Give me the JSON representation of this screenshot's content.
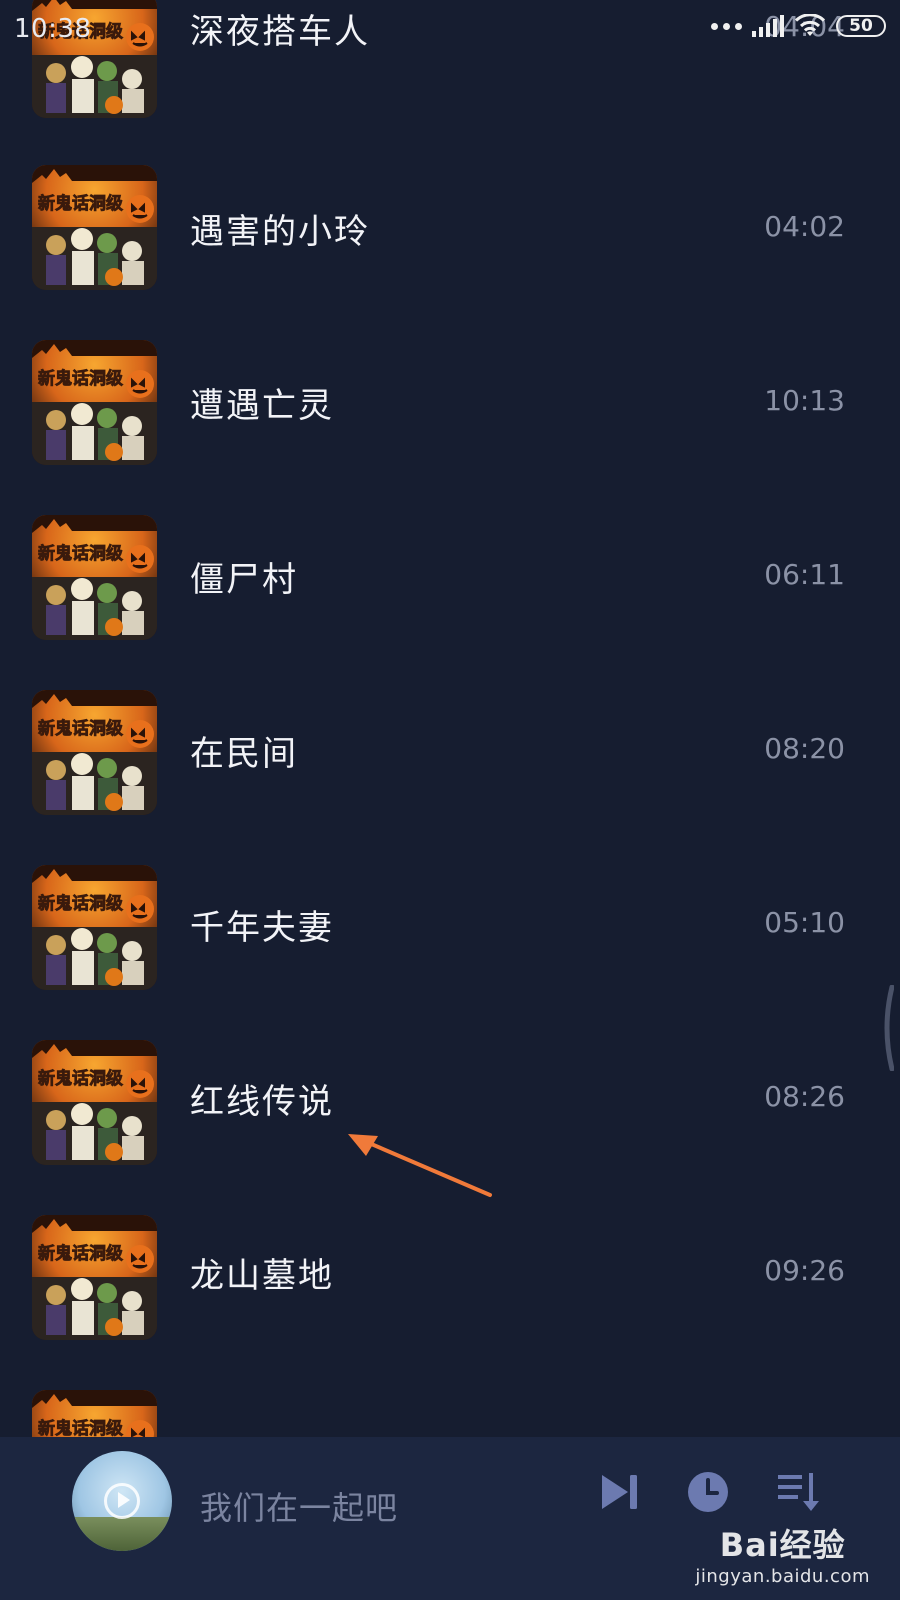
{
  "status_bar": {
    "time": "10:38",
    "battery": "50"
  },
  "tracks": [
    {
      "title": "深夜搭车人",
      "duration": "04:04"
    },
    {
      "title": "遇害的小玲",
      "duration": "04:02"
    },
    {
      "title": "遭遇亡灵",
      "duration": "10:13"
    },
    {
      "title": "僵尸村",
      "duration": "06:11"
    },
    {
      "title": "在民间",
      "duration": "08:20"
    },
    {
      "title": "千年夫妻",
      "duration": "05:10"
    },
    {
      "title": "红线传说",
      "duration": "08:26"
    },
    {
      "title": "龙山墓地",
      "duration": "09:26"
    },
    {
      "title": "",
      "duration": ""
    }
  ],
  "cover_text": "新鬼话洞级",
  "player": {
    "now_playing": "我们在一起吧",
    "icons": [
      "next-track-icon",
      "timer-icon",
      "playlist-icon"
    ]
  },
  "watermark": {
    "logo": "Bai经验",
    "url": "jingyan.baidu.com"
  },
  "colors": {
    "background": "#161d30",
    "player_bar": "#1c2640",
    "title": "#f2f3f7",
    "duration": "#8b92a6",
    "accent": "#6c7ab0",
    "annotation": "#f07a3a"
  }
}
